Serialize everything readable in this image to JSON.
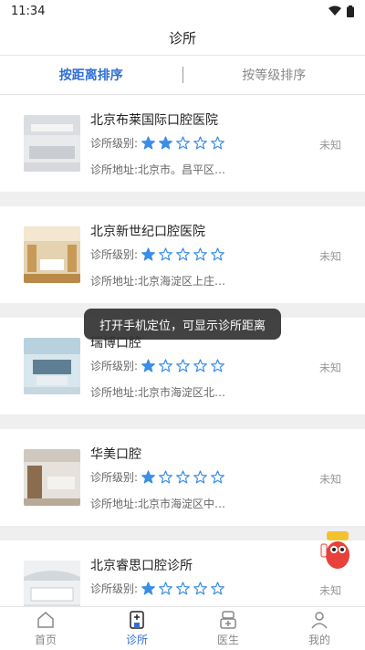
{
  "status_bar": {
    "time": "11:34"
  },
  "header": {
    "title": "诊所"
  },
  "sort_tabs": [
    {
      "label": "按距离排序",
      "active": true
    },
    {
      "label": "按等级排序",
      "active": false
    }
  ],
  "clinics": [
    {
      "name": "北京布莱国际口腔医院",
      "level_label": "诊所级别:",
      "rating": 2,
      "max_rating": 5,
      "address": "诊所地址:北京市。昌平区…",
      "distance": "未知"
    },
    {
      "name": "北京新世纪口腔医院",
      "level_label": "诊所级别:",
      "rating": 1,
      "max_rating": 5,
      "address": "诊所地址:北京海淀区上庄…",
      "distance": "未知"
    },
    {
      "name": "瑞博口腔",
      "level_label": "诊所级别:",
      "rating": 1,
      "max_rating": 5,
      "address": "诊所地址:北京市海淀区北…",
      "distance": "未知"
    },
    {
      "name": "华美口腔",
      "level_label": "诊所级别:",
      "rating": 1,
      "max_rating": 5,
      "address": "诊所地址:北京市海淀区中…",
      "distance": "未知"
    },
    {
      "name": "北京睿思口腔诊所",
      "level_label": "诊所级别:",
      "rating": 1,
      "max_rating": 5,
      "address": "",
      "distance": "未知"
    }
  ],
  "toast": {
    "text": "打开手机定位，可显示诊所距离"
  },
  "tabbar": [
    {
      "label": "首页",
      "icon": "home-icon",
      "active": false
    },
    {
      "label": "诊所",
      "icon": "clinic-icon",
      "active": true
    },
    {
      "label": "医生",
      "icon": "doctor-icon",
      "active": false
    },
    {
      "label": "我的",
      "icon": "user-icon",
      "active": false
    }
  ],
  "colors": {
    "accent": "#2f6fd6",
    "star": "#3a8ee6"
  }
}
